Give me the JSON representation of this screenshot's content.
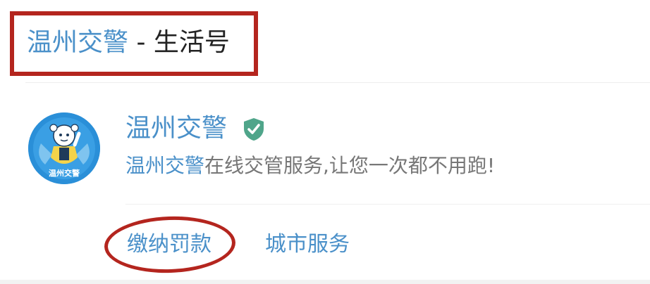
{
  "header": {
    "title_main": "温州交警",
    "title_sep": " - ",
    "title_sub": "生活号"
  },
  "account": {
    "name": "温州交警",
    "verified_icon": "verified-shield-check-icon",
    "avatar_text": "温州交警",
    "description_prefix": "温州交警",
    "description_rest": "在线交管服务,让您一次都不用跑!"
  },
  "services": [
    {
      "label": "缴纳罚款"
    },
    {
      "label": "城市服务"
    }
  ],
  "colors": {
    "link_blue": "#4a90c9",
    "annotation_red": "#b4251e",
    "verified_green": "#4fa58a",
    "avatar_blue": "#2a8fd8"
  }
}
